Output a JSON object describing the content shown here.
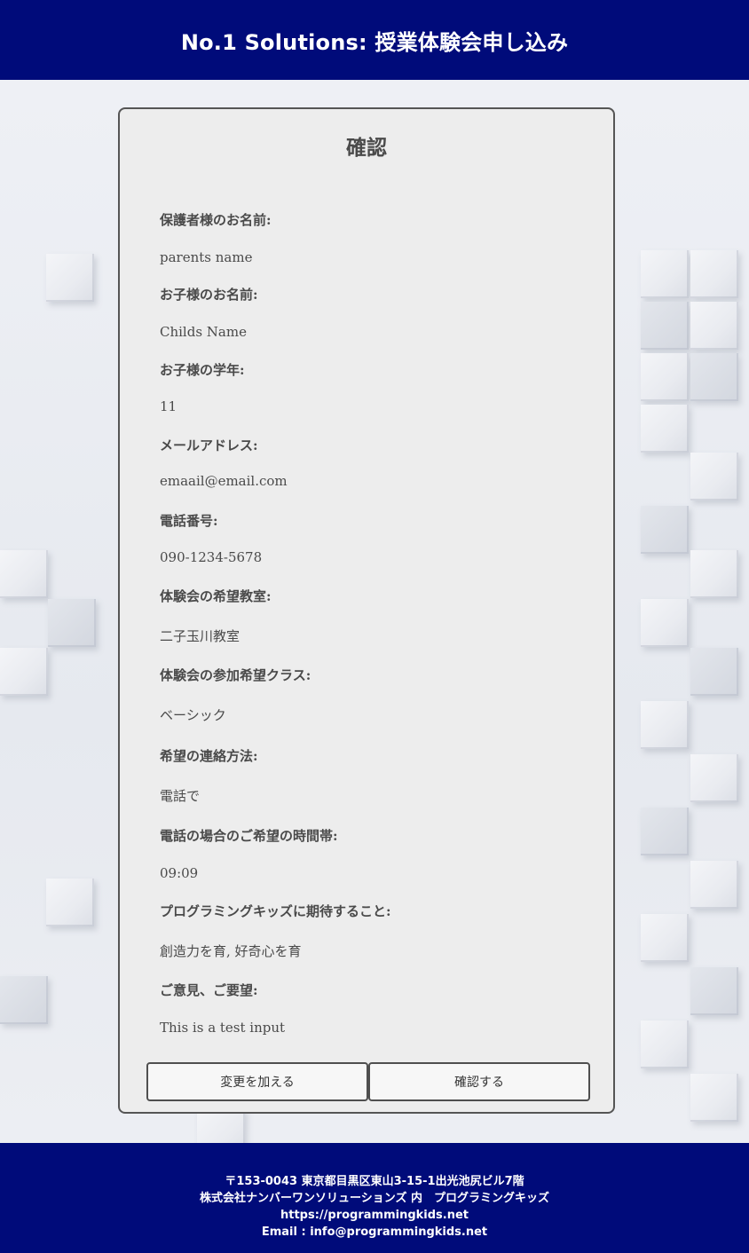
{
  "header": {
    "title": "No.1 Solutions: 授業体験会申し込み"
  },
  "card": {
    "title": "確認",
    "fields": [
      {
        "label": "保護者様のお名前:",
        "value": "parents name"
      },
      {
        "label": "お子様のお名前:",
        "value": "Childs Name"
      },
      {
        "label": "お子様の学年:",
        "value": "11"
      },
      {
        "label": "メールアドレス:",
        "value": "emaail@email.com"
      },
      {
        "label": "電話番号:",
        "value": "090-1234-5678"
      },
      {
        "label": "体験会の希望教室:",
        "value": "二子玉川教室"
      },
      {
        "label": "体験会の参加希望クラス:",
        "value": "ベーシック"
      },
      {
        "label": "希望の連絡方法:",
        "value": "電話で"
      },
      {
        "label": "電話の場合のご希望の時間帯:",
        "value": "09:09"
      },
      {
        "label": "プログラミングキッズに期待すること:",
        "value": "創造力を育, 好奇心を育"
      },
      {
        "label": "ご意見、ご要望:",
        "value": "This is a test input"
      }
    ],
    "buttons": {
      "edit": "変更を加える",
      "confirm": "確認する"
    }
  },
  "footer": {
    "address": "〒153-0043 東京都目黒区東山3-15-1出光池尻ビル7階",
    "company": "株式会社ナンバーワンソリューションズ 内　プログラミングキッズ",
    "url": "https://programmingkids.net",
    "email": "Email : info@programmingkids.net"
  },
  "colors": {
    "header_bg": "#000b7a",
    "footer_bg": "#000b7a",
    "card_bg": "#ededed",
    "card_border": "#555555"
  }
}
